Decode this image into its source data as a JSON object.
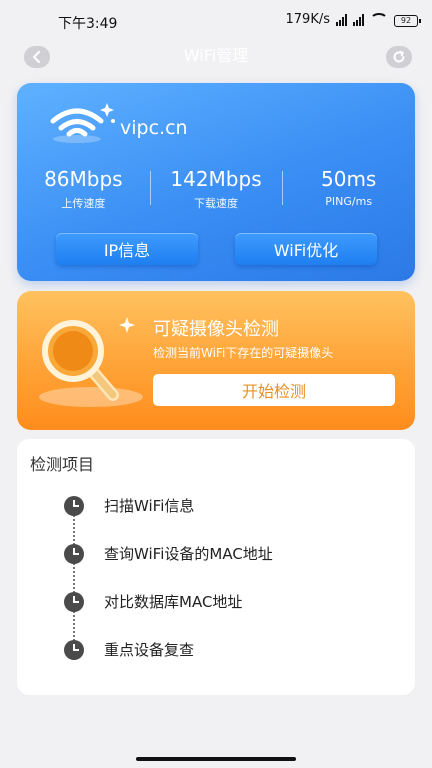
{
  "status_bar": {
    "time": "下午3:49",
    "net_speed": "179K/s",
    "battery": "92"
  },
  "header": {
    "title": "WiFi管理",
    "back_icon": "chevron-left-icon",
    "refresh_icon": "refresh-icon"
  },
  "wifi_card": {
    "ssid": "vipc.cn",
    "upload": {
      "value": "86Mbps",
      "label": "上传速度"
    },
    "download": {
      "value": "142Mbps",
      "label": "下载速度"
    },
    "ping": {
      "value": "50ms",
      "label": "PING/ms"
    },
    "ip_button": "IP信息",
    "optimize_button": "WiFi优化",
    "colors": {
      "gradient_start": "#5fb1ff",
      "gradient_end": "#2b79e6"
    }
  },
  "camera_card": {
    "title": "可疑摄像头检测",
    "description": "检测当前WiFi下存在的可疑摄像头",
    "start_button": "开始检测",
    "colors": {
      "gradient_start": "#ffc25f",
      "gradient_end": "#ff8d1c"
    }
  },
  "detection": {
    "title": "检测项目",
    "items": [
      {
        "label": "扫描WiFi信息",
        "icon": "clock-icon"
      },
      {
        "label": "查询WiFi设备的MAC地址",
        "icon": "clock-icon"
      },
      {
        "label": "对比数据库MAC地址",
        "icon": "clock-icon"
      },
      {
        "label": "重点设备复查",
        "icon": "clock-icon"
      }
    ]
  }
}
